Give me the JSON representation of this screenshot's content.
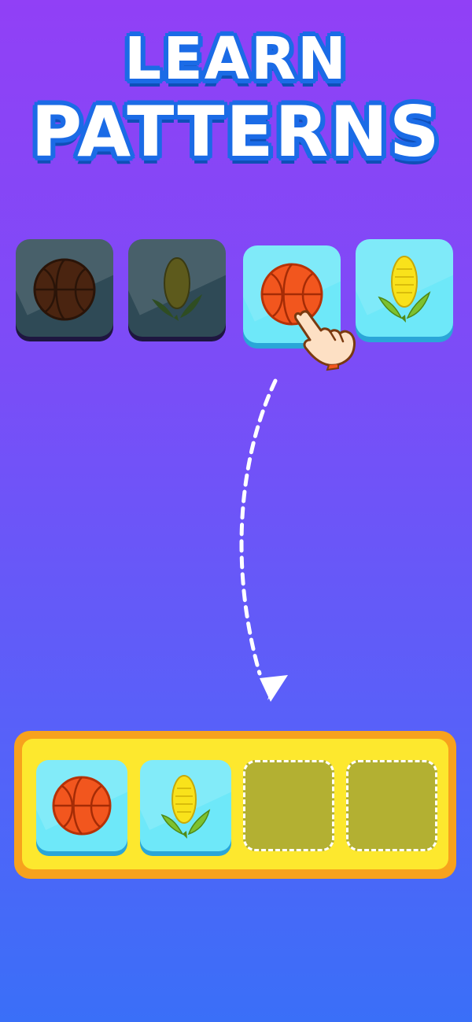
{
  "title": {
    "line1": "LEARN",
    "line2": "PATTERNS"
  },
  "colors": {
    "background_top": "#9140f6",
    "background_bottom": "#3a6ff8",
    "title_outline": "#1b6be6",
    "tile_light": "#6ee8f9",
    "tile_dark": "#2f4a56",
    "tray_border": "#f7a21d",
    "tray_fill": "#fde82e",
    "empty_slot": "#b3b032"
  },
  "pattern_row": [
    {
      "item": "basketball",
      "state": "dimmed"
    },
    {
      "item": "corn",
      "state": "dimmed"
    },
    {
      "item": "basketball",
      "state": "active"
    },
    {
      "item": "corn",
      "state": "active"
    }
  ],
  "answer_tray": [
    {
      "item": "basketball",
      "state": "filled"
    },
    {
      "item": "corn",
      "state": "filled"
    },
    {
      "item": "",
      "state": "empty"
    },
    {
      "item": "",
      "state": "empty"
    }
  ],
  "icons": {
    "pointer": "hand-pointer-icon",
    "arrow": "dashed-arrow-down-icon"
  }
}
